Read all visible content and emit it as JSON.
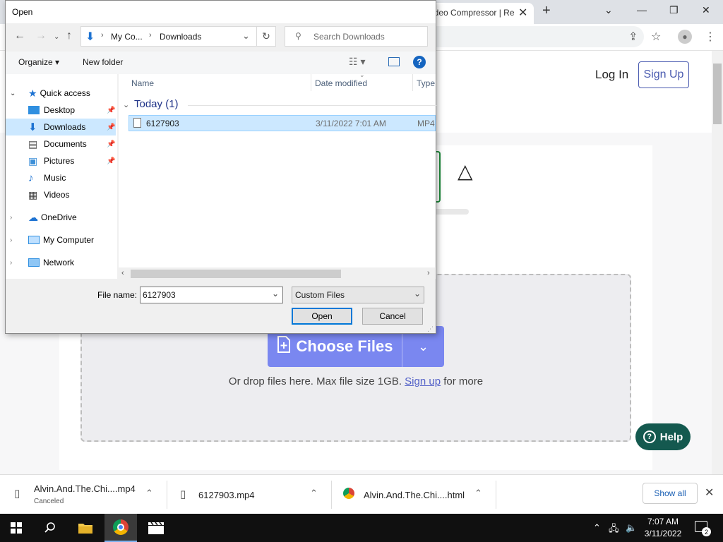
{
  "browser": {
    "tab_title": "ideo Compressor | Re",
    "new_tab_label": "+",
    "window_controls": [
      "chevron-down-icon",
      "minimize-icon",
      "restore-icon",
      "close-icon"
    ]
  },
  "website": {
    "login_label": "Log In",
    "signup_label": "Sign Up",
    "choose_files_label": "Choose Files",
    "drop_text_before": "Or drop files here. Max file size 1GB.",
    "drop_link": "Sign up",
    "drop_text_after": "for more",
    "help_label": "Help"
  },
  "dialog": {
    "title": "Open",
    "breadcrumb": [
      "My Co...",
      "Downloads"
    ],
    "search_placeholder": "Search Downloads",
    "toolbar": {
      "organize_label": "Organize",
      "new_folder_label": "New folder"
    },
    "nav": {
      "quick_access": "Quick access",
      "items": [
        {
          "label": "Desktop",
          "pinned": true
        },
        {
          "label": "Downloads",
          "pinned": true,
          "selected": true
        },
        {
          "label": "Documents",
          "pinned": true
        },
        {
          "label": "Pictures",
          "pinned": true
        },
        {
          "label": "Music",
          "pinned": false
        },
        {
          "label": "Videos",
          "pinned": false
        }
      ],
      "onedrive": "OneDrive",
      "my_computer": "My Computer",
      "network": "Network"
    },
    "columns": [
      "Name",
      "Date modified",
      "Type"
    ],
    "group_label": "Today (1)",
    "files": [
      {
        "name": "6127903",
        "date": "3/11/2022 7:01 AM",
        "type": "MP4"
      }
    ],
    "file_name_label": "File name:",
    "file_name_value": "6127903",
    "file_type_value": "Custom Files",
    "open_label": "Open",
    "cancel_label": "Cancel"
  },
  "downloads": {
    "items": [
      {
        "name": "Alvin.And.The.Chi....mp4",
        "status": "Canceled"
      },
      {
        "name": "6127903.mp4",
        "status": ""
      },
      {
        "name": "Alvin.And.The.Chi....html",
        "status": ""
      }
    ],
    "show_all_label": "Show all"
  },
  "taskbar": {
    "time": "7:07 AM",
    "date": "3/11/2022",
    "notification_count": "2"
  },
  "colors": {
    "accent": "#0078d7",
    "choose_button": "#7a87f0",
    "help_button": "#14594f",
    "signup_border": "#4a5bb0",
    "selection": "#cce8ff"
  }
}
